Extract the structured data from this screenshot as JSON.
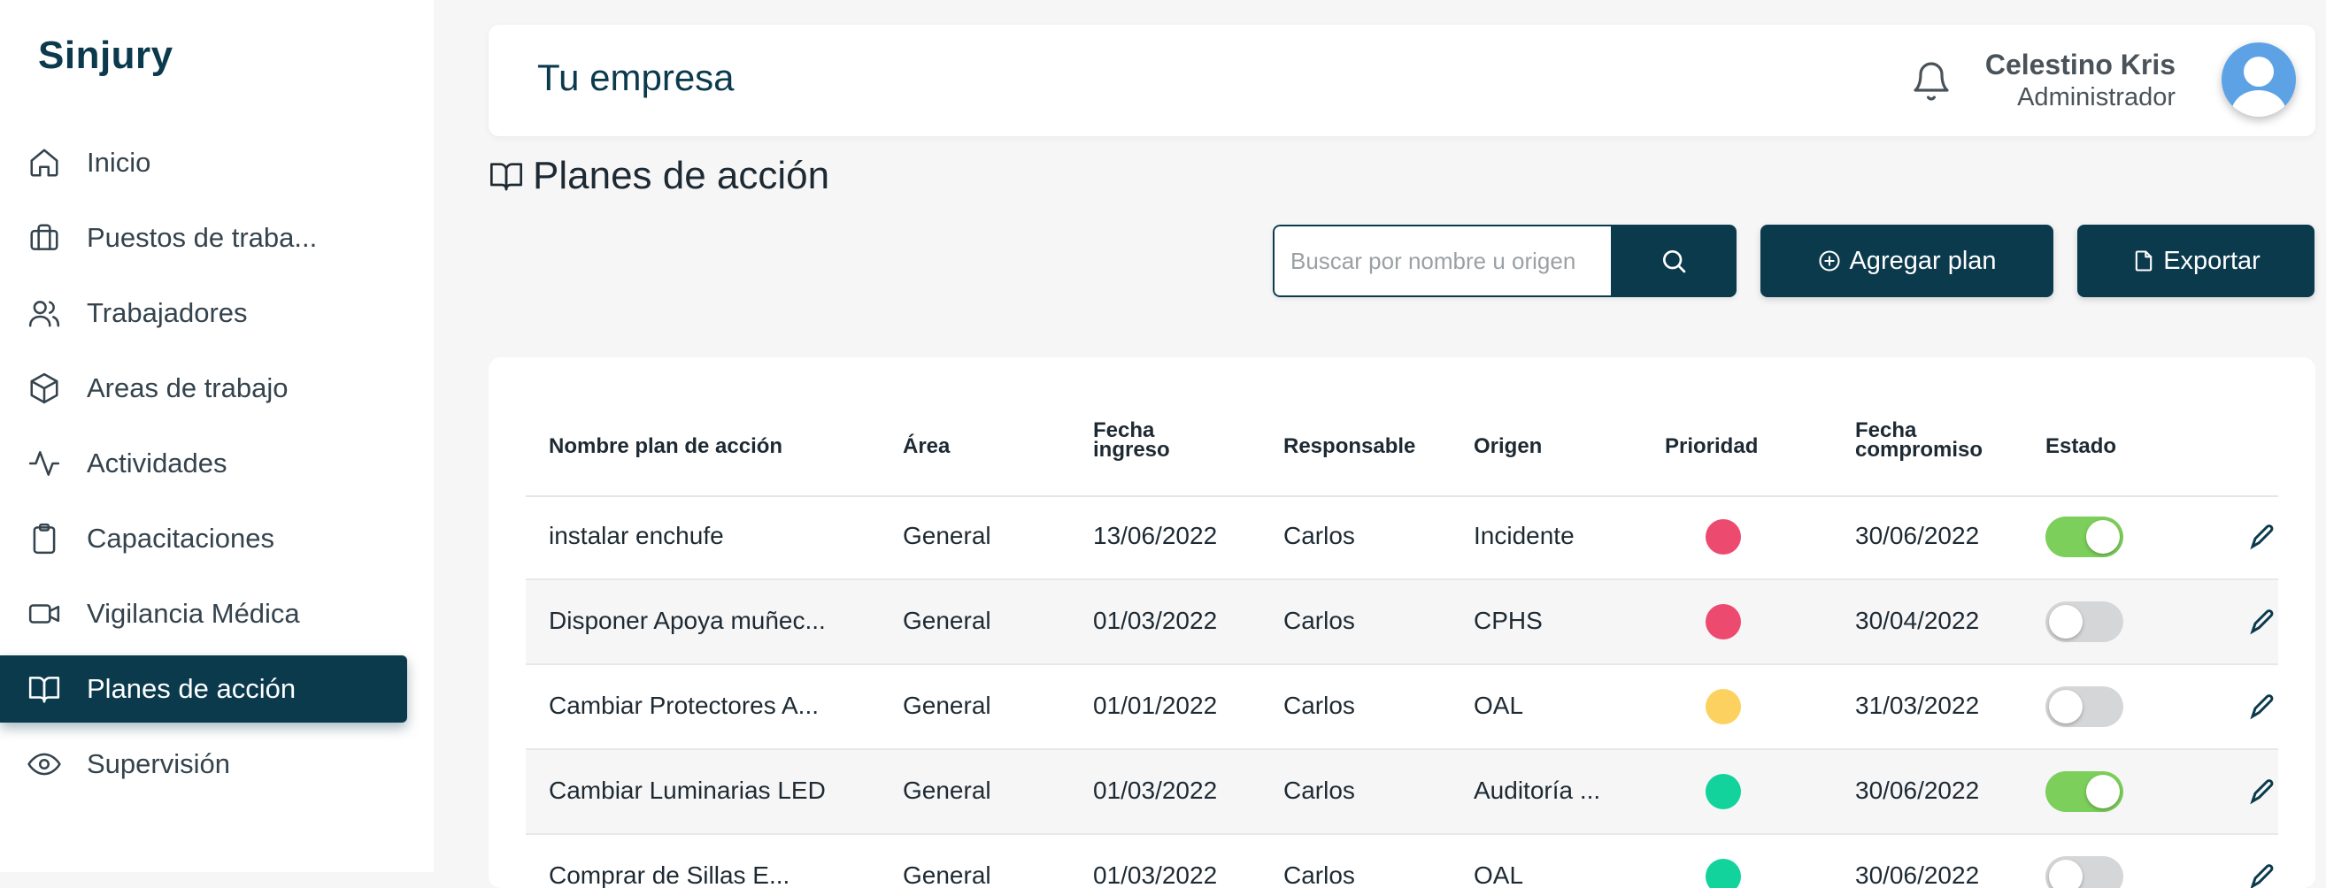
{
  "brand": "Sinjury",
  "nav": [
    {
      "label": "Inicio",
      "icon": "home-icon",
      "active": false
    },
    {
      "label": "Puestos de traba...",
      "icon": "briefcase-icon",
      "active": false
    },
    {
      "label": "Trabajadores",
      "icon": "users-icon",
      "active": false
    },
    {
      "label": "Areas de trabajo",
      "icon": "box-icon",
      "active": false
    },
    {
      "label": "Actividades",
      "icon": "activity-icon",
      "active": false
    },
    {
      "label": "Capacitaciones",
      "icon": "clipboard-icon",
      "active": false
    },
    {
      "label": "Vigilancia Médica",
      "icon": "video-icon",
      "active": false
    },
    {
      "label": "Planes de acción",
      "icon": "book-open-icon",
      "active": true
    },
    {
      "label": "Supervisión",
      "icon": "eye-icon",
      "active": false
    }
  ],
  "header": {
    "company": "Tu empresa",
    "user_name": "Celestino Kris",
    "user_role": "Administrador"
  },
  "page_title": "Planes de acción",
  "search": {
    "placeholder": "Buscar por nombre u origen",
    "value": ""
  },
  "buttons": {
    "add": "Agregar plan",
    "export": "Exportar"
  },
  "table": {
    "headers": [
      "Nombre plan de acción",
      "Área",
      "Fecha\ningreso",
      "Responsable",
      "Origen",
      "Prioridad",
      "Fecha\ncompromiso",
      "Estado"
    ],
    "rows": [
      {
        "name": "instalar enchufe",
        "area": "General",
        "ingreso": "13/06/2022",
        "responsable": "Carlos",
        "origen": "Incidente",
        "prioridad": "alta",
        "compromiso": "30/06/2022",
        "estado": true
      },
      {
        "name": "Disponer Apoya muñec...",
        "area": "General",
        "ingreso": "01/03/2022",
        "responsable": "Carlos",
        "origen": "CPHS",
        "prioridad": "alta",
        "compromiso": "30/04/2022",
        "estado": false
      },
      {
        "name": "Cambiar Protectores A...",
        "area": "General",
        "ingreso": "01/01/2022",
        "responsable": "Carlos",
        "origen": "OAL",
        "prioridad": "media",
        "compromiso": "31/03/2022",
        "estado": false
      },
      {
        "name": "Cambiar Luminarias LED",
        "area": "General",
        "ingreso": "01/03/2022",
        "responsable": "Carlos",
        "origen": "Auditoría ...",
        "prioridad": "baja",
        "compromiso": "30/06/2022",
        "estado": true
      },
      {
        "name": "Comprar de Sillas E...",
        "area": "General",
        "ingreso": "01/03/2022",
        "responsable": "Carlos",
        "origen": "OAL",
        "prioridad": "baja",
        "compromiso": "30/06/2022",
        "estado": false
      }
    ]
  },
  "colors": {
    "brand": "#0b3a4d",
    "priority_alta": "#ec4a6e",
    "priority_media": "#fdd15f",
    "priority_baja": "#12d39b",
    "toggle_on": "#7ccf5a",
    "toggle_off": "#d4d6d8"
  }
}
